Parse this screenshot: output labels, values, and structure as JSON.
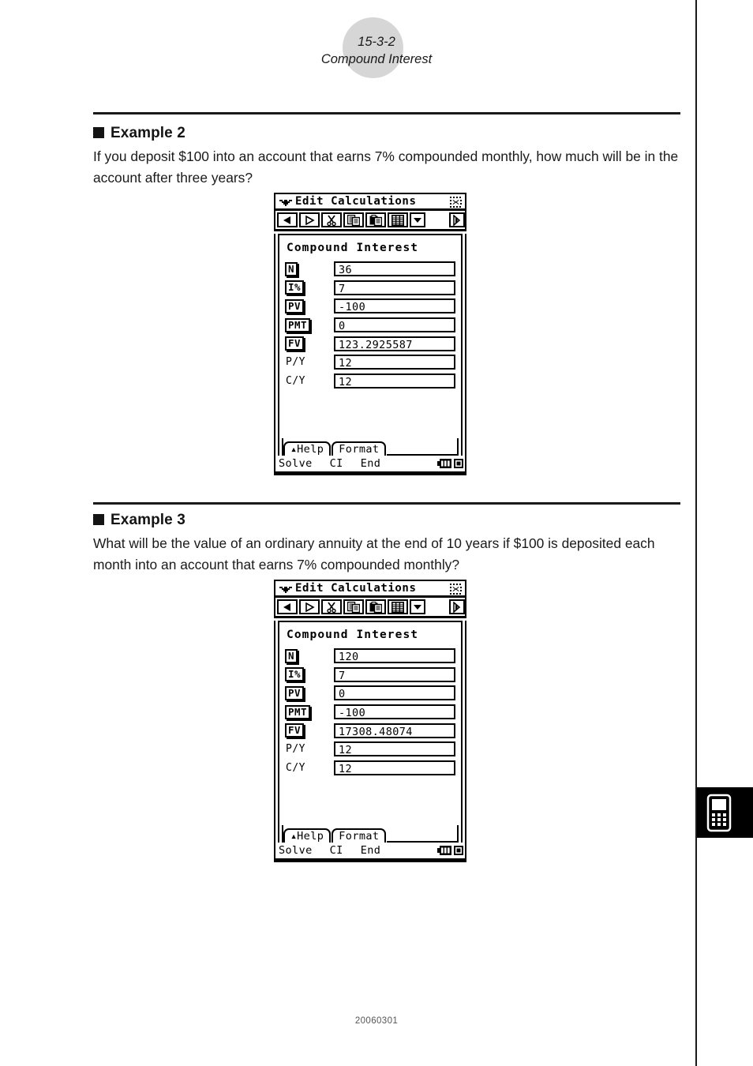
{
  "header": {
    "section_number": "15-3-2",
    "section_title": "Compound Interest"
  },
  "examples": [
    {
      "heading": "Example 2",
      "body": "If you deposit $100 into an account that earns 7% compounded monthly, how much will be in the account after three years?"
    },
    {
      "heading": "Example 3",
      "body": "What will be the value of an ordinary annuity at the end of 10 years if $100 is deposited each month into an account that earns 7% compounded monthly?"
    }
  ],
  "calculators": [
    {
      "titlebar": {
        "title": "Edit Calculations",
        "menu_icon": "bat-menu-icon",
        "close_icon": "close-icon"
      },
      "toolbar": {
        "buttons": [
          "back-arrow-icon",
          "forward-arrow-icon",
          "cut-scissors-icon",
          "copy-icon",
          "paste-icon",
          "table-grid-icon",
          "dropdown-arrow-icon",
          "next-page-icon"
        ]
      },
      "panel_title": "Compound Interest",
      "fields": [
        {
          "label": "N",
          "boxed": true,
          "value": "36"
        },
        {
          "label": "I%",
          "boxed": true,
          "value": "7"
        },
        {
          "label": "PV",
          "boxed": true,
          "value": "-100"
        },
        {
          "label": "PMT",
          "boxed": true,
          "value": "0"
        },
        {
          "label": "FV",
          "boxed": true,
          "value": "123.2925587"
        },
        {
          "label": "P/Y",
          "boxed": false,
          "value": "12"
        },
        {
          "label": "C/Y",
          "boxed": false,
          "value": "12"
        }
      ],
      "tabs": [
        {
          "label": "Help",
          "arrow": "▴"
        },
        {
          "label": "Format",
          "arrow": ""
        }
      ],
      "status": {
        "mode": "Solve",
        "calc": "CI",
        "payment": "End",
        "battery_icon": "battery-icon",
        "indicator_icon": "square-indicator-icon"
      }
    },
    {
      "titlebar": {
        "title": "Edit Calculations",
        "menu_icon": "bat-menu-icon",
        "close_icon": "close-icon"
      },
      "toolbar": {
        "buttons": [
          "back-arrow-icon",
          "forward-arrow-icon",
          "cut-scissors-icon",
          "copy-icon",
          "paste-icon",
          "table-grid-icon",
          "dropdown-arrow-icon",
          "next-page-icon"
        ]
      },
      "panel_title": "Compound Interest",
      "fields": [
        {
          "label": "N",
          "boxed": true,
          "value": "120"
        },
        {
          "label": "I%",
          "boxed": true,
          "value": "7"
        },
        {
          "label": "PV",
          "boxed": true,
          "value": "0"
        },
        {
          "label": "PMT",
          "boxed": true,
          "value": "-100"
        },
        {
          "label": "FV",
          "boxed": true,
          "value": "17308.48074"
        },
        {
          "label": "P/Y",
          "boxed": false,
          "value": "12"
        },
        {
          "label": "C/Y",
          "boxed": false,
          "value": "12"
        }
      ],
      "tabs": [
        {
          "label": "Help",
          "arrow": "▴"
        },
        {
          "label": "Format",
          "arrow": ""
        }
      ],
      "status": {
        "mode": "Solve",
        "calc": "CI",
        "payment": "End",
        "battery_icon": "battery-icon",
        "indicator_icon": "square-indicator-icon"
      }
    }
  ],
  "device_tab": {
    "icon": "calculator-device-icon"
  },
  "footer": {
    "text": "20060301"
  }
}
